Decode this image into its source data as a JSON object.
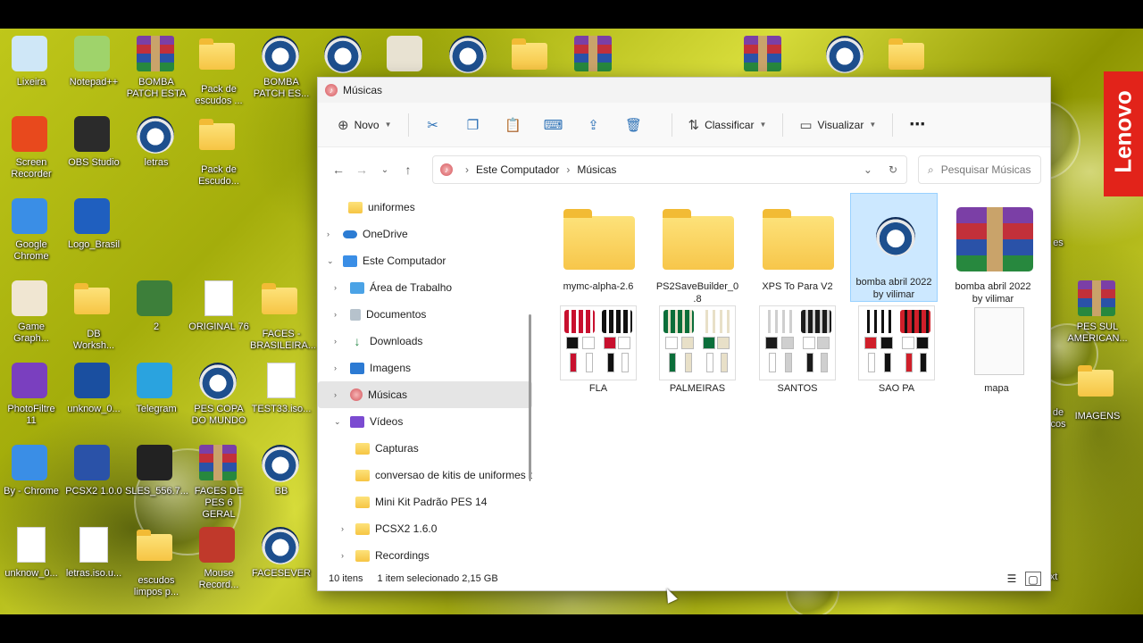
{
  "desktop": {
    "icons": [
      {
        "label": "Lixeira",
        "icon": "recycle-bin-icon",
        "type": "generic",
        "color": "#cfe7f7"
      },
      {
        "label": "Notepad++",
        "icon": "notepad-plus-icon",
        "type": "generic",
        "color": "#9fd36b"
      },
      {
        "label": "BOMBA\nPATCH ESTA",
        "icon": "winrar-icon",
        "type": "rar"
      },
      {
        "label": "Pack de\nescudos ...",
        "icon": "folder-icon",
        "type": "folder"
      },
      {
        "label": "BOMBA\nPATCH ES...",
        "icon": "pes-icon",
        "type": "pes"
      },
      {
        "label": "",
        "icon": "pes-icon",
        "type": "pes"
      },
      {
        "label": "",
        "icon": "app-icon",
        "type": "generic",
        "color": "#e8e2d2"
      },
      {
        "label": "",
        "icon": "pes-icon",
        "type": "pes"
      },
      {
        "label": "",
        "icon": "folder-icon",
        "type": "folder"
      },
      {
        "label": "",
        "icon": "winrar-icon",
        "type": "rar"
      },
      {
        "label": "",
        "icon": "winrar-icon",
        "type": "rar"
      },
      {
        "label": "",
        "icon": "pes-icon",
        "type": "pes"
      },
      {
        "label": "",
        "icon": "folder-icon",
        "type": "folder"
      },
      {
        "label": "Screen\nRecorder",
        "icon": "screen-recorder-icon",
        "type": "generic",
        "color": "#e8491d"
      },
      {
        "label": "OBS Studio",
        "icon": "obs-icon",
        "type": "generic",
        "color": "#2b2b2b"
      },
      {
        "label": "letras",
        "icon": "pes-icon",
        "type": "pes"
      },
      {
        "label": "Pack de\nEscudo...",
        "icon": "folder-icon",
        "type": "folder"
      },
      {
        "label": "Google\nChrome",
        "icon": "chrome-icon",
        "type": "generic",
        "color": "#3a8ee6"
      },
      {
        "label": "Logo_Brasil",
        "icon": "brasil-logo-icon",
        "type": "generic",
        "color": "#1f5fbf"
      },
      {
        "label": "Game\nGraph...",
        "icon": "game-graph-icon",
        "type": "generic",
        "color": "#f0e6d2"
      },
      {
        "label": "DB\nWorksh...",
        "icon": "folder-icon",
        "type": "folder"
      },
      {
        "label": "2",
        "icon": "image-file-icon",
        "type": "generic",
        "color": "#3d7f3a"
      },
      {
        "label": "ORIGINAL 76",
        "icon": "document-icon",
        "type": "doc"
      },
      {
        "label": "FACES -\nBRASILEIRA...",
        "icon": "folder-icon",
        "type": "folder"
      },
      {
        "label": "PES SUL\nAMERICAN...",
        "icon": "winrar-icon",
        "type": "rar"
      },
      {
        "label": "PhotoFiltre\n11",
        "icon": "photofiltre-icon",
        "type": "generic",
        "color": "#7a3fbf"
      },
      {
        "label": "unknow_0...",
        "icon": "str-icon",
        "type": "generic",
        "color": "#1a4fa0"
      },
      {
        "label": "Telegram",
        "icon": "telegram-icon",
        "type": "generic",
        "color": "#2aa3df"
      },
      {
        "label": "PES COPA\nDO MUNDO",
        "icon": "pes-icon",
        "type": "pes"
      },
      {
        "label": "TEST33.iso...",
        "icon": "document-icon",
        "type": "doc"
      },
      {
        "label": "IMAGENS",
        "icon": "folder-icon",
        "type": "folder"
      },
      {
        "label": "By - Chrome",
        "icon": "chrome-icon",
        "type": "generic",
        "color": "#3a8ee6"
      },
      {
        "label": "PCSX2 1.0.0",
        "icon": "pcsx2-icon",
        "type": "generic",
        "color": "#2a52a8"
      },
      {
        "label": "SLES_556.7...",
        "icon": "cover-image-icon",
        "type": "generic",
        "color": "#222222"
      },
      {
        "label": "FACES DE\nPES 6 GERAL",
        "icon": "winrar-icon",
        "type": "rar"
      },
      {
        "label": "BB",
        "icon": "pes-icon",
        "type": "pes"
      },
      {
        "label": "unknow_0...",
        "icon": "document-icon",
        "type": "doc"
      },
      {
        "label": "letras.iso.u...",
        "icon": "document-icon",
        "type": "doc"
      },
      {
        "label": "escudos\nlimpos p...",
        "icon": "folder-icon",
        "type": "folder"
      },
      {
        "label": "Mouse\nRecord...",
        "icon": "mouse-recorder-icon",
        "type": "generic",
        "color": "#c0392b"
      },
      {
        "label": "FACESEVER",
        "icon": "pes-icon",
        "type": "pes"
      }
    ],
    "partial_labels": [
      "es",
      "de\ncos",
      "xt"
    ]
  },
  "window": {
    "title": "Músicas",
    "toolbar": {
      "new_label": "Novo",
      "sort_label": "Classificar",
      "view_label": "Visualizar",
      "more_label": "⋯"
    },
    "address": {
      "root": "Este Computador",
      "current": "Músicas",
      "search_placeholder": "Pesquisar Músicas"
    },
    "nav": [
      {
        "label": "uniformes",
        "icon": "fold",
        "indent": 1,
        "exp": ""
      },
      {
        "label": "OneDrive",
        "icon": "cloud",
        "indent": 0,
        "exp": "›"
      },
      {
        "label": "Este Computador",
        "icon": "pc",
        "indent": 0,
        "exp": "⌄"
      },
      {
        "label": "Área de Trabalho",
        "icon": "desk",
        "indent": 1,
        "exp": "›"
      },
      {
        "label": "Documentos",
        "icon": "doc",
        "indent": 1,
        "exp": "›"
      },
      {
        "label": "Downloads",
        "icon": "dl",
        "indent": 1,
        "exp": "›"
      },
      {
        "label": "Imagens",
        "icon": "img",
        "indent": 1,
        "exp": "›"
      },
      {
        "label": "Músicas",
        "icon": "mus",
        "indent": 1,
        "exp": "›",
        "selected": true
      },
      {
        "label": "Vídeos",
        "icon": "vid",
        "indent": 1,
        "exp": "⌄"
      },
      {
        "label": "Capturas",
        "icon": "fold",
        "indent": 2,
        "exp": ""
      },
      {
        "label": "conversao de kitis de uniformes p",
        "icon": "fold",
        "indent": 2,
        "exp": ""
      },
      {
        "label": "Mini Kit Padrão PES 14",
        "icon": "fold",
        "indent": 2,
        "exp": ""
      },
      {
        "label": "PCSX2 1.6.0",
        "icon": "fold",
        "indent": 2,
        "exp": "›"
      },
      {
        "label": "Recordings",
        "icon": "fold",
        "indent": 2,
        "exp": "›"
      }
    ],
    "files": [
      {
        "name": "mymc-alpha-2.6",
        "kind": "folder"
      },
      {
        "name": "PS2SaveBuilder_0\n.8",
        "kind": "folder"
      },
      {
        "name": "XPS To Para V2",
        "kind": "folder"
      },
      {
        "name": "bomba abril 2022\nby vilimar",
        "kind": "pes",
        "selected": true
      },
      {
        "name": "bomba abril 2022\nby vilimar",
        "kind": "rar"
      },
      {
        "name": "FLA",
        "kind": "kit",
        "colors": [
          "#c8102e",
          "#111111",
          "#ffffff"
        ]
      },
      {
        "name": "PALMEIRAS",
        "kind": "kit",
        "colors": [
          "#0b6e3a",
          "#ffffff",
          "#e8e0c8"
        ]
      },
      {
        "name": "SANTOS",
        "kind": "kit",
        "colors": [
          "#ffffff",
          "#1b1b1b",
          "#cfcfcf"
        ]
      },
      {
        "name": "SAO PA",
        "kind": "kit",
        "colors": [
          "#ffffff",
          "#d01f2a",
          "#111111"
        ]
      },
      {
        "name": "mapa",
        "kind": "doc"
      }
    ],
    "status": {
      "count": "10 itens",
      "selection": "1 item selecionado  2,15 GB"
    }
  },
  "brand": {
    "text": "Lenovo",
    "color": "#e2231a"
  },
  "colors": {
    "selection_bg": "#cce8ff",
    "accent": "#2a6fb5"
  }
}
